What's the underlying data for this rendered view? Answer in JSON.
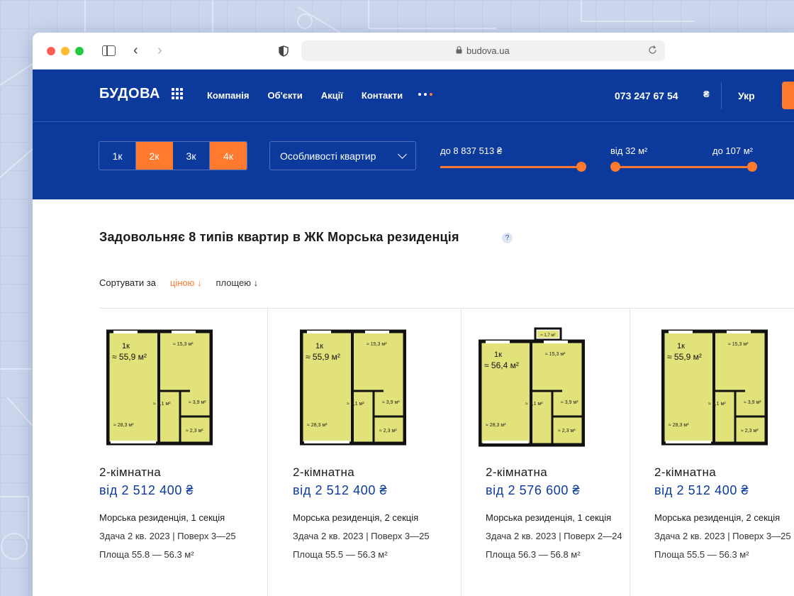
{
  "browser": {
    "url": "budova.ua"
  },
  "header": {
    "logo": "БУДОВА",
    "menu": [
      "Компанія",
      "Об'єкти",
      "Акції",
      "Контакти"
    ],
    "phone": "073 247 67 54",
    "currency": "₴",
    "language": "Укр"
  },
  "filters": {
    "rooms": [
      {
        "label": "1к",
        "active": false
      },
      {
        "label": "2к",
        "active": true
      },
      {
        "label": "3к",
        "active": false
      },
      {
        "label": "4к",
        "active": true
      }
    ],
    "features_label": "Особливості квартир",
    "price_label": "до 8 837 513 ₴",
    "area_from_label": "від 32 м²",
    "area_to_label": "до 107 м²",
    "accent_color": "#ff7a2e",
    "brand_color": "#0b3a9c"
  },
  "results": {
    "title": "Задовольняє 8 типів квартир в ЖК Морська резиденція",
    "help": "?",
    "sort_label": "Сортувати за",
    "sort_price": "ціною ↓",
    "sort_area": "площею ↓"
  },
  "cards": [
    {
      "plan": {
        "rooms": "1к",
        "area": "≈ 55,9 м²",
        "r1": "≈ 15,3 м²",
        "r2": "≈ 6,1 м²",
        "r3": "≈ 3,9 м²",
        "r4": "≈ 28,3 м²",
        "r5": "≈ 2,3 м²",
        "balcony": ""
      },
      "title": "2-кімнатна",
      "price": "від 2 512 400 ₴",
      "complex": "Морська резиденція, 1 секція",
      "meta": "Здача 2 кв. 2023 | Поверх 3—25",
      "area": "Площа 55.8 — 56.3 м²"
    },
    {
      "plan": {
        "rooms": "1к",
        "area": "≈ 55,9 м²",
        "r1": "≈ 15,3 м²",
        "r2": "≈ 6,1 м²",
        "r3": "≈ 3,9 м²",
        "r4": "≈ 28,3 м²",
        "r5": "≈ 2,3 м²",
        "balcony": ""
      },
      "title": "2-кімнатна",
      "price": "від 2 512 400 ₴",
      "complex": "Морська резиденція, 2 секція",
      "meta": "Здача 2 кв. 2023 | Поверх 3—25",
      "area": "Площа 55.5 — 56.3 м²"
    },
    {
      "plan": {
        "rooms": "1к",
        "area": "≈ 56,4 м²",
        "r1": "≈ 15,3 м²",
        "r2": "≈ 6,1 м²",
        "r3": "≈ 3,9 м²",
        "r4": "≈ 28,3 м²",
        "r5": "≈ 2,3 м²",
        "balcony": "≈ 1,7 м²"
      },
      "title": "2-кімнатна",
      "price": "від 2 576 600 ₴",
      "complex": "Морська резиденція, 1 секція",
      "meta": "Здача 2 кв. 2023 | Поверх 2—24",
      "area": "Площа 56.3 — 56.8 м²"
    },
    {
      "plan": {
        "rooms": "1к",
        "area": "≈ 55,9 м²",
        "r1": "≈ 15,3 м²",
        "r2": "≈ 6,1 м²",
        "r3": "≈ 3,9 м²",
        "r4": "≈ 28,3 м²",
        "r5": "≈ 2,3 м²",
        "balcony": ""
      },
      "title": "2-кімнатна",
      "price": "від 2 512 400 ₴",
      "complex": "Морська резиденція, 2 секція",
      "meta": "Здача 2 кв. 2023 | Поверх 3—25",
      "area": "Площа 55.5 — 56.3 м²"
    }
  ]
}
